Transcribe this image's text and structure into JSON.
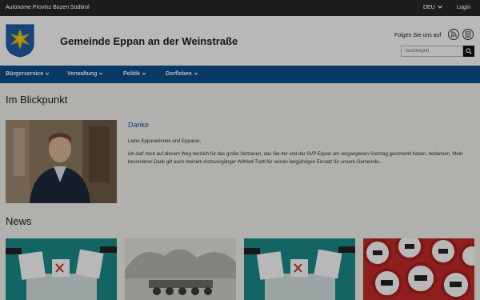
{
  "topbar": {
    "province": "Autonome Provinz Bozen Südtirol",
    "language": "DEU",
    "login": "Login"
  },
  "header": {
    "title": "Gemeinde Eppan an der Weinstraße",
    "follow_text": "Folgen Sie uns auf",
    "search_placeholder": "Suchbegriff"
  },
  "nav": {
    "items": [
      {
        "label": "Bürgerservice"
      },
      {
        "label": "Verwaltung"
      },
      {
        "label": "Politik"
      },
      {
        "label": "Dorfleben"
      }
    ]
  },
  "blickpunkt": {
    "heading": "Im Blickpunkt",
    "article": {
      "title": "Danke",
      "greeting": "Liebe Eppanerinnen und Eppaner,",
      "body": "ich darf mich auf diesem Weg herzlich für das große Vertrauen, das Sie mir und der SVP Eppan am vergangenen Sonntag geschenkt haben, bedanken. Mein besonderer Dank gilt auch meinem Amtsvorgänger Wilfried Trettl für seinen langjährigen Einsatz für unsere Gemeinde..."
    }
  },
  "news": {
    "heading": "News"
  },
  "colors": {
    "nav_bg": "#0a4f8f",
    "topbar_bg": "#1d1d1d",
    "link": "#1a5ea0",
    "crest_blue": "#1f5fb0",
    "crest_star": "#f2c200"
  },
  "icons": [
    "chevron-down-icon",
    "rss-icon",
    "newsletter-icon",
    "search-icon",
    "crest-logo"
  ]
}
